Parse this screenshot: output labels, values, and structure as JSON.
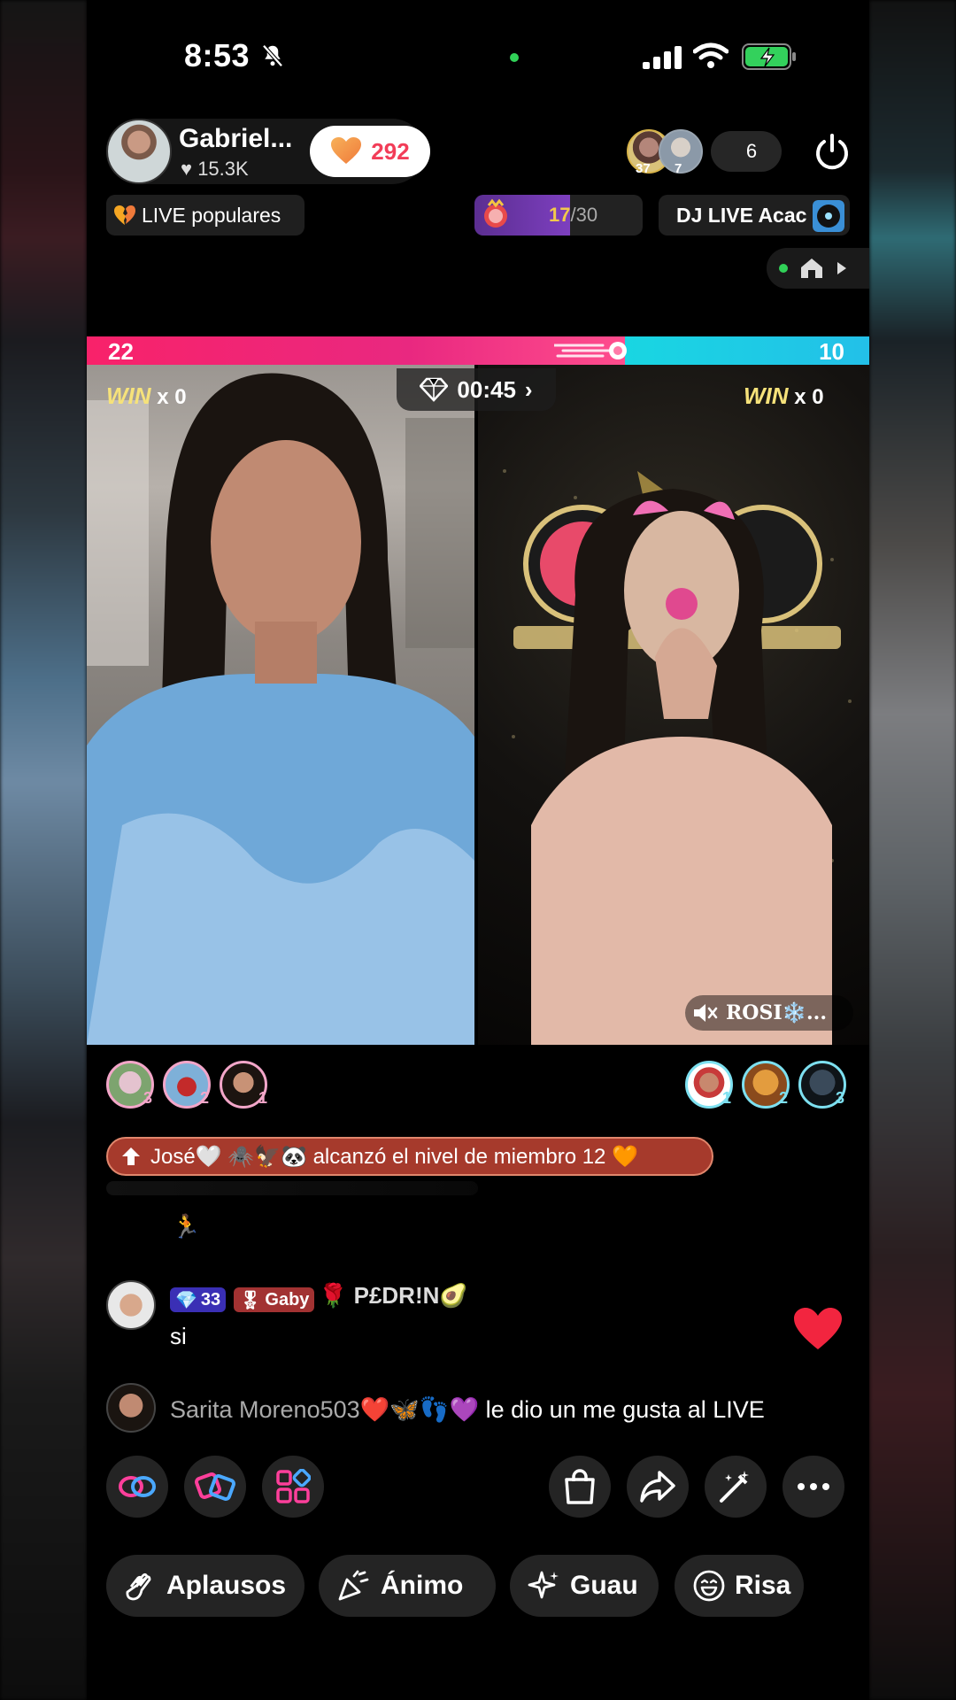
{
  "status_bar": {
    "time": "8:53"
  },
  "host": {
    "name": "Gabriel...",
    "likes": "15.3K",
    "follow_count": "292"
  },
  "viewers": {
    "badges": [
      "37",
      "7"
    ],
    "count": "6"
  },
  "row2": {
    "popular_label": "LIVE populares",
    "progress_current": "17",
    "progress_total": "/30",
    "progress_fraction": 0.57,
    "dj_label": "DJ LIVE Acac"
  },
  "battle": {
    "left_score": "22",
    "right_score": "10",
    "timer": "00:45",
    "left_win_label": "WIN",
    "left_win_count": "x 0",
    "right_win_label": "WIN",
    "right_win_count": "x 0",
    "opponent_name": "ROSI❄️..."
  },
  "supporters": {
    "left": [
      "3",
      "2",
      "1"
    ],
    "right": [
      "1",
      "2",
      "3"
    ]
  },
  "member_banner": "José🤍 🕷️🦅🐼 alcanzó el nivel de miembro 12 🧡",
  "comment": {
    "level": "33",
    "fan_badge": "Gaby",
    "username": "🌹 P£DR!N🥑",
    "text": "si"
  },
  "like_event": {
    "user": "Sarita Moreno503❤️🦋👣💜",
    "message": "le dio un me gusta al LIVE"
  },
  "actions": {
    "left": [
      "link-icon",
      "multi-guest-icon",
      "apps-icon"
    ],
    "right": [
      "shop-icon",
      "share-icon",
      "magic-wand-icon",
      "more-icon"
    ]
  },
  "reactions": [
    "Aplausos",
    "Ánimo",
    "Guau",
    "Risa"
  ],
  "colors": {
    "battle_left": "#f8226a",
    "battle_right": "#19d6e2",
    "like_red": "#f23d58",
    "member_banner": "#a63a2c"
  }
}
